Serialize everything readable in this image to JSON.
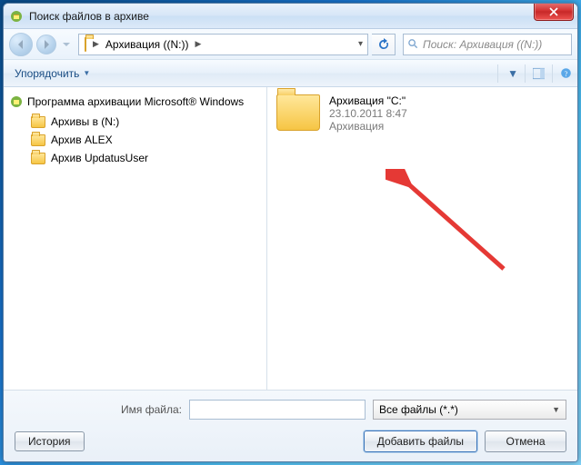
{
  "window": {
    "title": "Поиск файлов в архиве"
  },
  "nav": {
    "path_segment": "Архивация ((N:))",
    "search_placeholder": "Поиск: Архивация ((N:))"
  },
  "toolbar": {
    "organize": "Упорядочить"
  },
  "tree": {
    "root": "Программа архивации Microsoft® Windows",
    "items": [
      {
        "label": "Архивы в (N:)"
      },
      {
        "label": "Архив ALEX"
      },
      {
        "label": "Архив UpdatusUser"
      }
    ]
  },
  "list": {
    "items": [
      {
        "name": "Архивация \"C:\"",
        "date": "23.10.2011 8:47",
        "type": "Архивация"
      }
    ]
  },
  "bottom": {
    "filename_label": "Имя файла:",
    "filename_value": "",
    "filter": "Все файлы (*.*)",
    "history": "История",
    "add": "Добавить файлы",
    "cancel": "Отмена"
  }
}
